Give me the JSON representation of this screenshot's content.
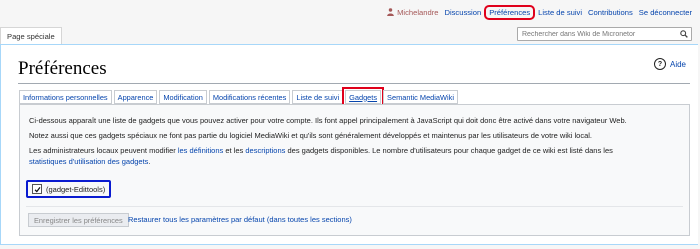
{
  "personal": {
    "username": "Michelandre",
    "discussion": "Discussion",
    "preferences": "Préférences",
    "watchlist": "Liste de suivi",
    "contributions": "Contributions",
    "logout": "Se déconnecter"
  },
  "tab_special": "Page spéciale",
  "search": {
    "placeholder": "Rechercher dans Wiki de Micronetor"
  },
  "page": {
    "title": "Préférences",
    "help": "Aide"
  },
  "tabs": [
    "Informations personnelles",
    "Apparence",
    "Modification",
    "Modifications récentes",
    "Liste de suivi",
    "Gadgets",
    "Semantic MediaWiki"
  ],
  "selected_tab": "Gadgets",
  "intro": {
    "p1": "Ci-dessous apparaît une liste de gadgets que vous pouvez activer pour votre compte. Ils font appel principalement à JavaScript qui doit donc être activé dans votre navigateur Web.",
    "p2": "Notez aussi que ces gadgets spéciaux ne font pas partie du logiciel MediaWiki et qu'ils sont généralement développés et maintenus par les utilisateurs de votre wiki local.",
    "p3_a": "Les administrateurs locaux peuvent modifier ",
    "p3_link1": "les définitions",
    "p3_b": " et les ",
    "p3_link2": "descriptions",
    "p3_c": " des gadgets disponibles. Le nombre d'utilisateurs pour chaque gadget de ce wiki est listé dans les",
    "p3_link3": "statistiques d'utilisation des gadgets",
    "p3_d": "."
  },
  "gadget": {
    "label": "(gadget-Edittools)",
    "checked": true
  },
  "buttons": {
    "save": "Enregistrer les préférences",
    "reset": "Restaurer tous les paramètres par défaut (dans toutes les sections)"
  }
}
